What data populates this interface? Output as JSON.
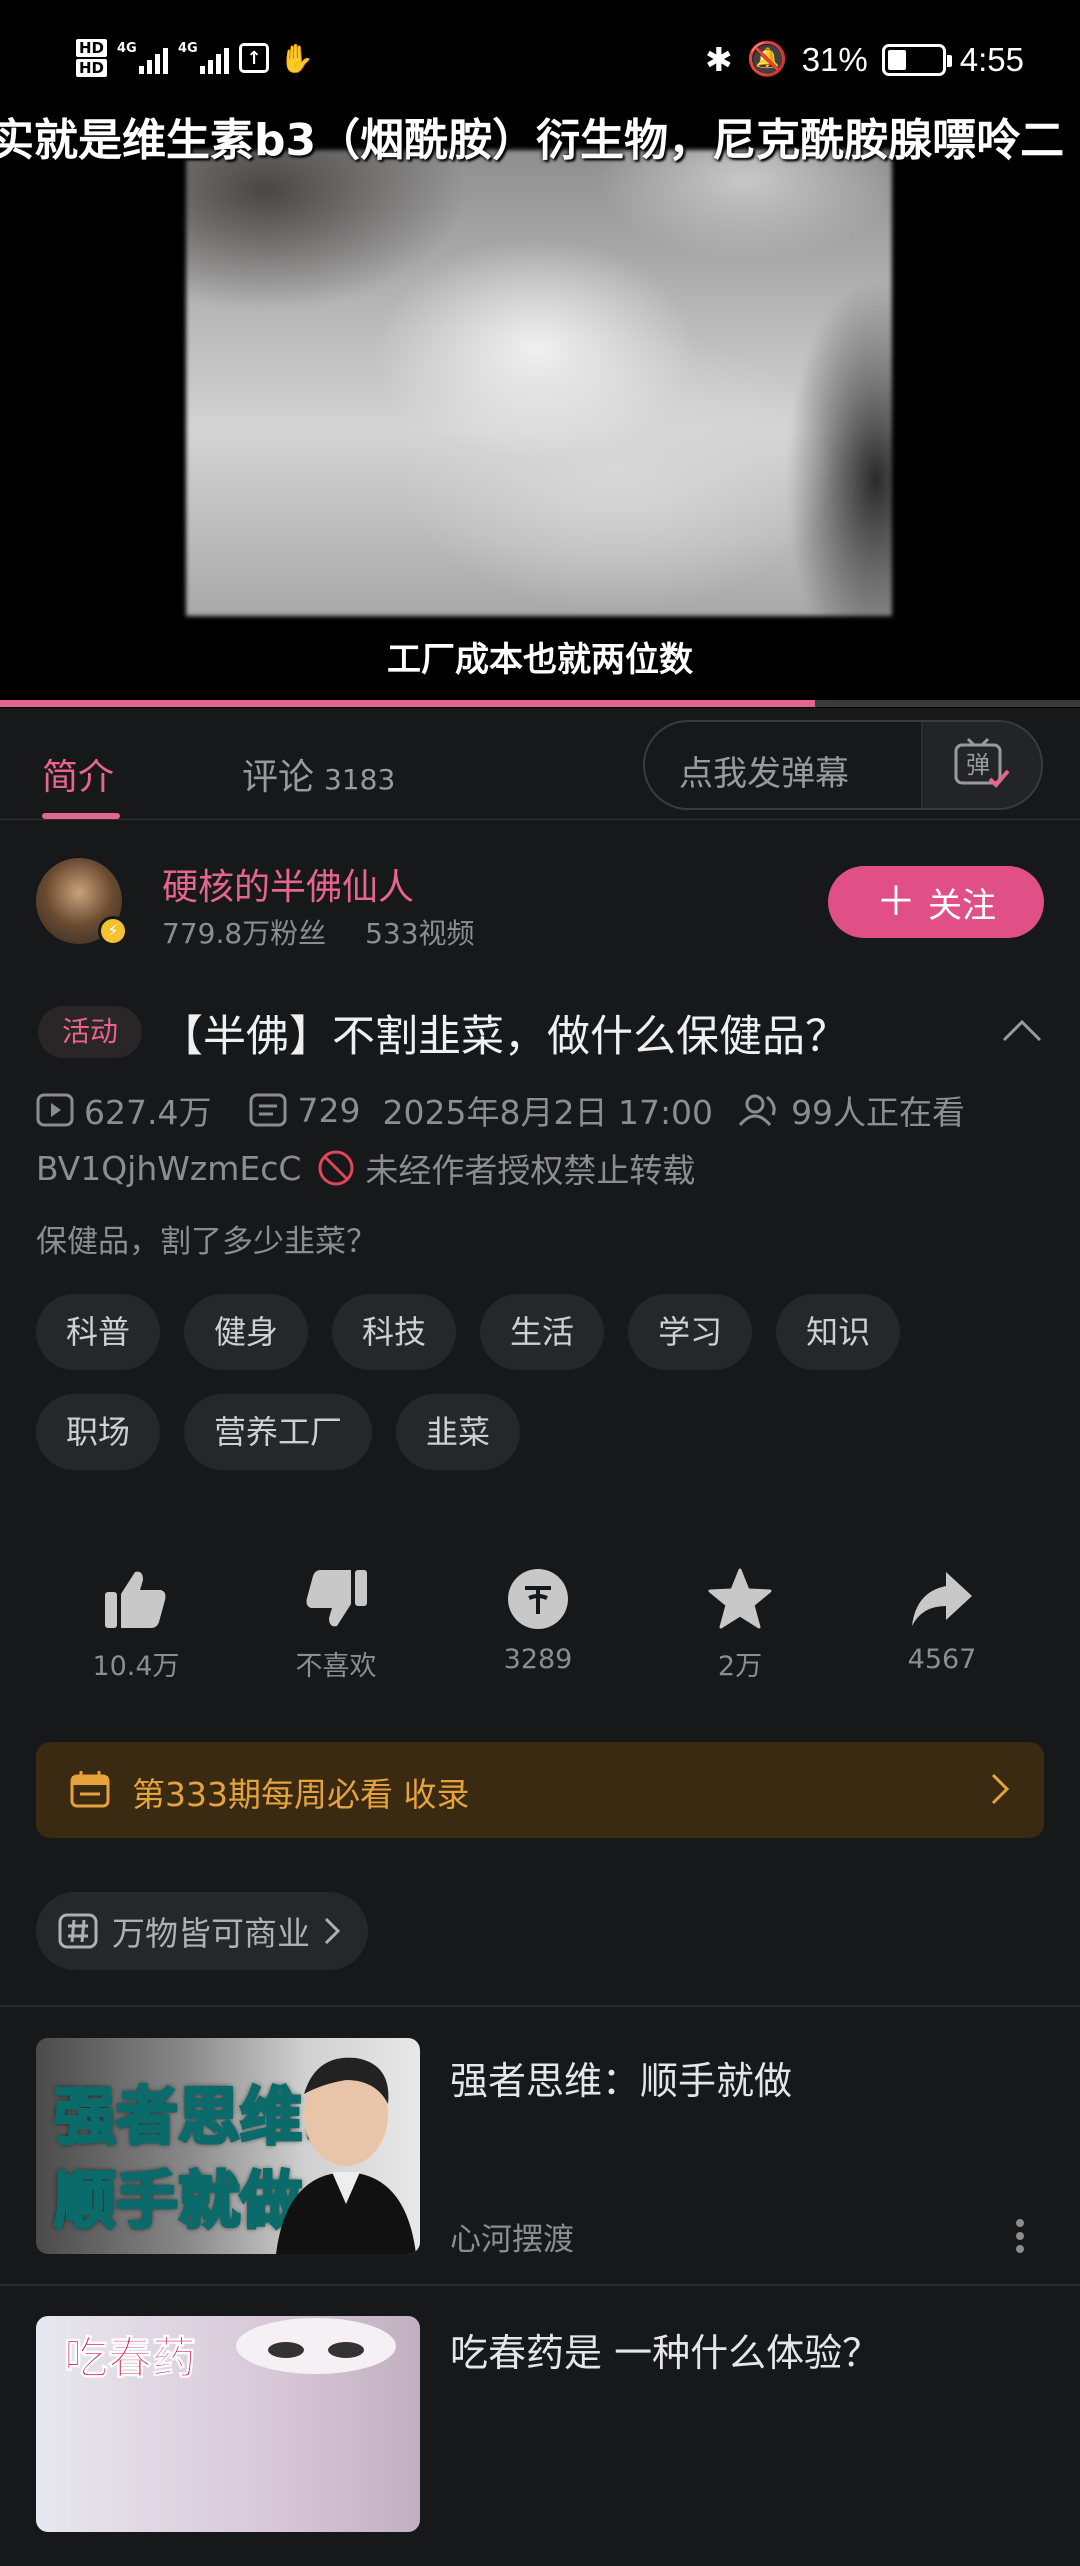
{
  "status_bar": {
    "battery_percent": "31%",
    "time": "4:55",
    "hd1": "HD",
    "hd2": "HD",
    "net1": "4G",
    "net2": "4G"
  },
  "video": {
    "danmaku": "实就是维生素b3（烟酰胺）衍生物，尼克酰胺腺嘌呤二",
    "subtitle": "工厂成本也就两位数",
    "progress_fraction": 0.755
  },
  "tabs": {
    "intro": "简介",
    "comments": "评论",
    "comments_count": "3183",
    "danmaku_placeholder": "点我发弹幕"
  },
  "author": {
    "name": "硬核的半佛仙人",
    "fans": "779.8万粉丝",
    "videos": "533视频",
    "follow": "关注"
  },
  "video_info": {
    "badge": "活动",
    "title": "【半佛】不割韭菜，做什么保健品？",
    "plays": "627.4万",
    "danmaku_count": "729",
    "date": "2025年8月2日 17:00",
    "watching": "99人正在看",
    "bvid": "BV1QjhWzmEcC",
    "copyright": "未经作者授权禁止转载",
    "description": "保健品，割了多少韭菜？"
  },
  "tags": [
    "科普",
    "健身",
    "科技",
    "生活",
    "学习",
    "知识",
    "职场",
    "营养工厂",
    "韭菜"
  ],
  "actions": {
    "like": "10.4万",
    "dislike": "不喜欢",
    "coin": "3289",
    "favorite": "2万",
    "share": "4567"
  },
  "collection": "第333期每周必看 收录",
  "topic": "万物皆可商业",
  "recommendations": [
    {
      "title": "强者思维：顺手就做",
      "author": "心河摆渡",
      "thumb_line1": "强者思维:",
      "thumb_line2": "顺手就做"
    },
    {
      "title": "吃春药是 一种什么体验？",
      "author": "",
      "thumb_line1": "吃春药"
    }
  ],
  "colors": {
    "accent": "#e7658d",
    "follow_bg": "#e04f86",
    "background": "#17181a",
    "collection_text": "#e6a23c"
  }
}
